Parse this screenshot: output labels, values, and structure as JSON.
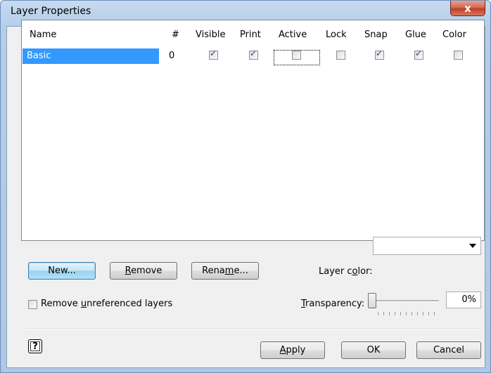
{
  "window": {
    "title": "Layer Properties",
    "close_glyph": "x"
  },
  "table": {
    "columns": [
      "Name",
      "#",
      "Visible",
      "Print",
      "Active",
      "Lock",
      "Snap",
      "Glue",
      "Color"
    ],
    "rows": [
      {
        "name": "Basic",
        "number": "0",
        "visible": true,
        "print": true,
        "active": false,
        "lock": false,
        "snap": true,
        "glue": true,
        "color": false
      }
    ]
  },
  "buttons": {
    "new": "New...",
    "remove_pre": "",
    "remove_ul": "R",
    "remove_post": "emove",
    "rename_pre": "Rena",
    "rename_ul": "m",
    "rename_post": "e...",
    "apply_pre": "",
    "apply_ul": "A",
    "apply_post": "pply",
    "ok": "OK",
    "cancel": "Cancel",
    "help_glyph": "?"
  },
  "layer_color": {
    "label_pre": "Layer c",
    "label_ul": "o",
    "label_post": "lor:",
    "value": ""
  },
  "remove_unreferenced": {
    "label_pre": "Remove ",
    "label_ul": "u",
    "label_post": "nreferenced layers",
    "checked": false
  },
  "transparency": {
    "label_pre": "",
    "label_ul": "T",
    "label_post": "ransparency:",
    "value": "0%",
    "level": 0
  },
  "colors": {
    "selection": "#3399ff",
    "check": "#21409a",
    "close": "#c23f25"
  }
}
